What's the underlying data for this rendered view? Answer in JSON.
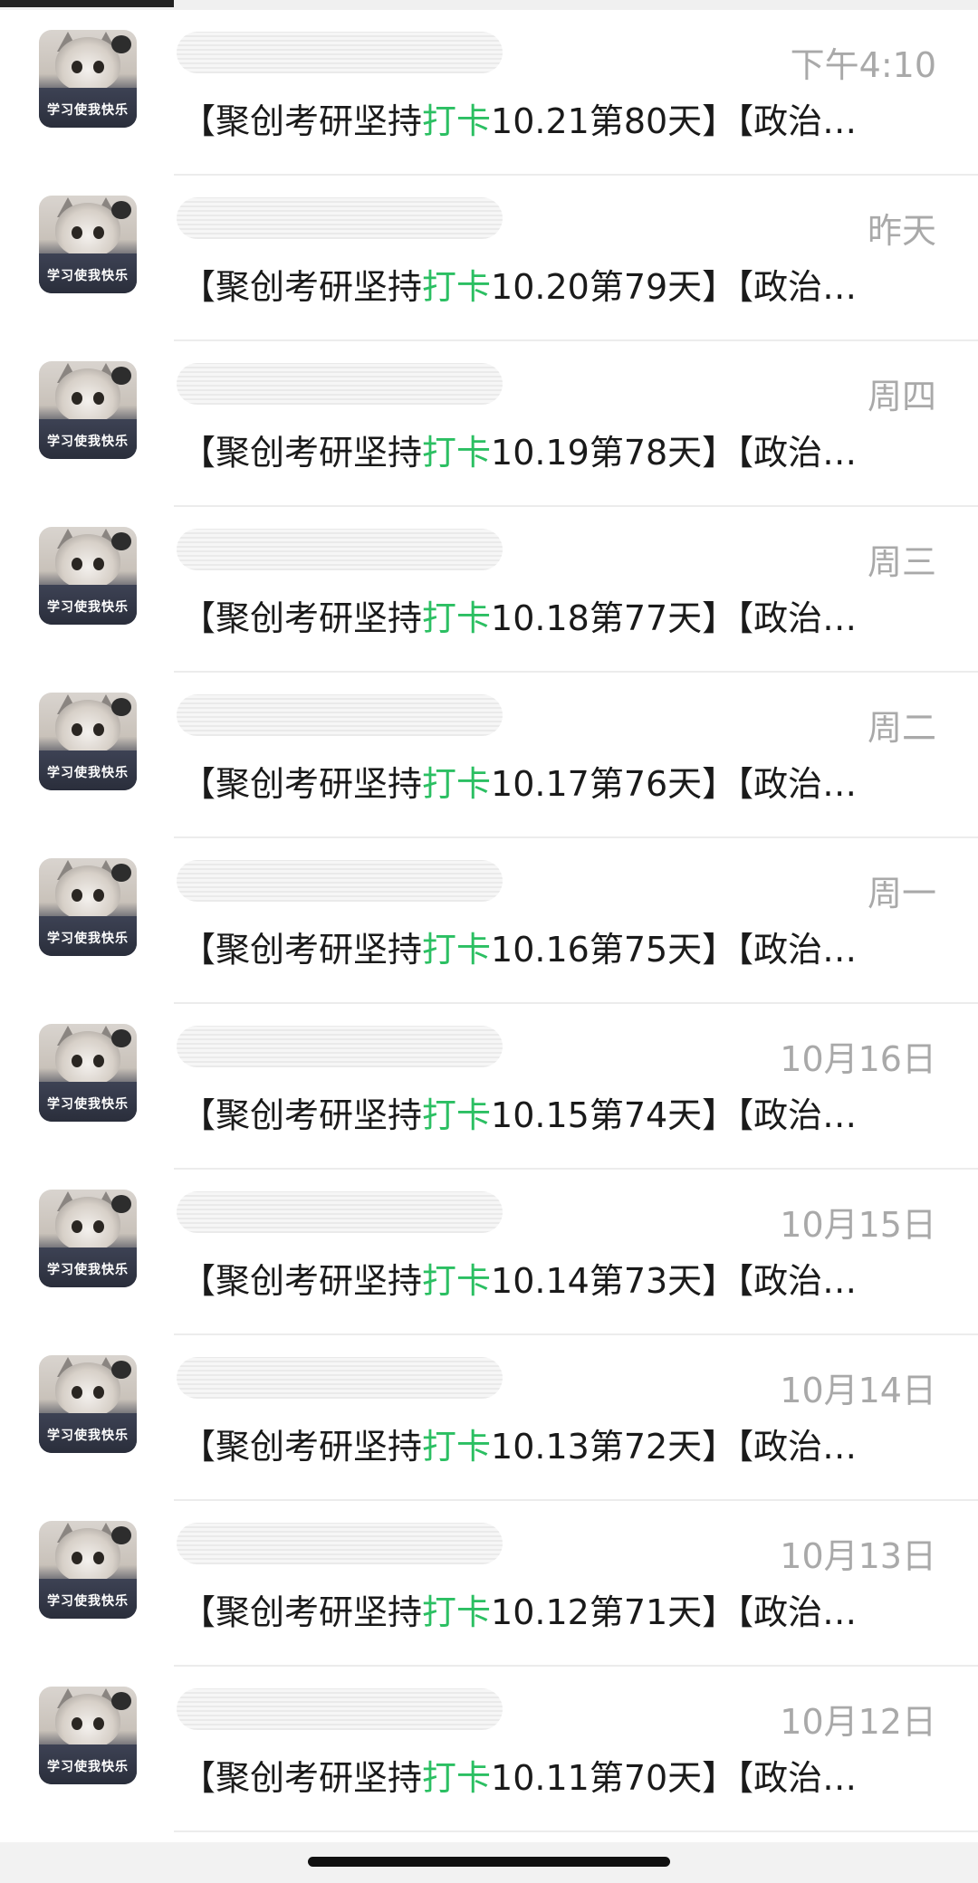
{
  "conversations": [
    {
      "time": "下午4:10",
      "message_prefix": "【聚创考研坚持",
      "message_highlight": "打卡",
      "message_suffix": "10.21第80天】【政治…"
    },
    {
      "time": "昨天",
      "message_prefix": "【聚创考研坚持",
      "message_highlight": "打卡",
      "message_suffix": "10.20第79天】【政治…"
    },
    {
      "time": "周四",
      "message_prefix": "【聚创考研坚持",
      "message_highlight": "打卡",
      "message_suffix": "10.19第78天】【政治…"
    },
    {
      "time": "周三",
      "message_prefix": "【聚创考研坚持",
      "message_highlight": "打卡",
      "message_suffix": "10.18第77天】【政治…"
    },
    {
      "time": "周二",
      "message_prefix": "【聚创考研坚持",
      "message_highlight": "打卡",
      "message_suffix": "10.17第76天】【政治…"
    },
    {
      "time": "周一",
      "message_prefix": "【聚创考研坚持",
      "message_highlight": "打卡",
      "message_suffix": "10.16第75天】【政治…"
    },
    {
      "time": "10月16日",
      "message_prefix": "【聚创考研坚持",
      "message_highlight": "打卡",
      "message_suffix": "10.15第74天】【政治…"
    },
    {
      "time": "10月15日",
      "message_prefix": "【聚创考研坚持",
      "message_highlight": "打卡",
      "message_suffix": "10.14第73天】【政治…"
    },
    {
      "time": "10月14日",
      "message_prefix": "【聚创考研坚持",
      "message_highlight": "打卡",
      "message_suffix": "10.13第72天】【政治…"
    },
    {
      "time": "10月13日",
      "message_prefix": "【聚创考研坚持",
      "message_highlight": "打卡",
      "message_suffix": "10.12第71天】【政治…"
    },
    {
      "time": "10月12日",
      "message_prefix": "【聚创考研坚持",
      "message_highlight": "打卡",
      "message_suffix": "10.11第70天】【政治…"
    }
  ],
  "avatar_caption": "学习使我快乐",
  "colors": {
    "highlight": "#2bbf62",
    "time_text": "#a9a9a9",
    "message_text": "#1a1a1a"
  }
}
